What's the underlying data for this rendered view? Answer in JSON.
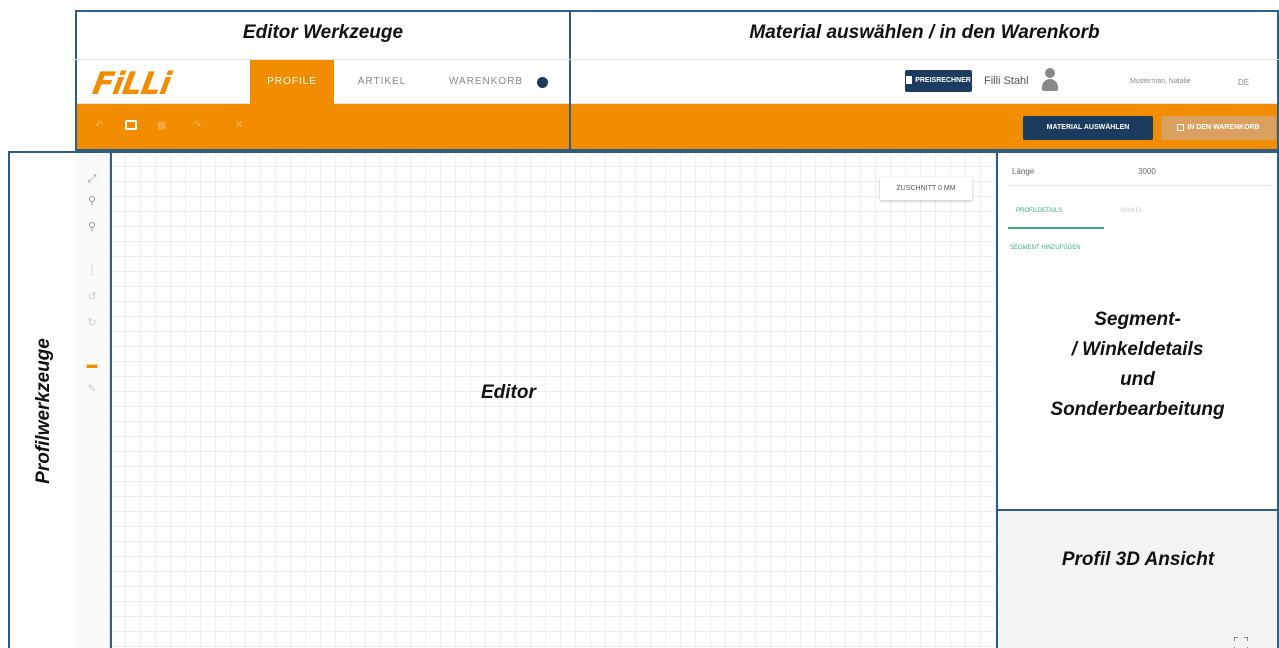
{
  "annotations": {
    "editor_tools": "Editor Werkzeuge",
    "material": "Material auswählen / in den Warenkorb",
    "profile_tools": "Profilwerkzeuge",
    "editor": "Editor",
    "segment_line1": "Segment-",
    "segment_line2": "/ Winkeldetails",
    "segment_line3": "und",
    "segment_line4": "Sonderbearbeitung",
    "view3d": "Profil 3D Ansicht"
  },
  "header": {
    "logo": "FiLLi",
    "tabs": [
      {
        "label": "PROFILE",
        "active": true
      },
      {
        "label": "ARTIKEL",
        "active": false
      },
      {
        "label": "WARENKORB",
        "active": false
      }
    ],
    "cart_count_icon": "cart-count-badge",
    "calc_button": "PREISRECHNER",
    "company": "Filli Stahl",
    "user": "Musterman, Natalie",
    "language": "DE"
  },
  "toolbar_right": {
    "select_material": "MATERIAL AUSWÄHLEN",
    "add_to_cart": "IN DEN WARENKORB"
  },
  "editor": {
    "zuschnitt": "ZUSCHNITT 0 MM"
  },
  "details_panel": {
    "length_label": "Länge",
    "length_value": "3000",
    "tabs": [
      {
        "label": "PROFILDETAILS",
        "active": true
      },
      {
        "label": "WINKEL",
        "active": false
      }
    ],
    "add_segment": "SEGMENT HINZUFÜGEN"
  },
  "colors": {
    "brand_orange": "#f28c00",
    "dark_blue": "#1b3c5e",
    "frame_blue": "#2d5c86",
    "accent_teal": "#3aaa8a"
  }
}
